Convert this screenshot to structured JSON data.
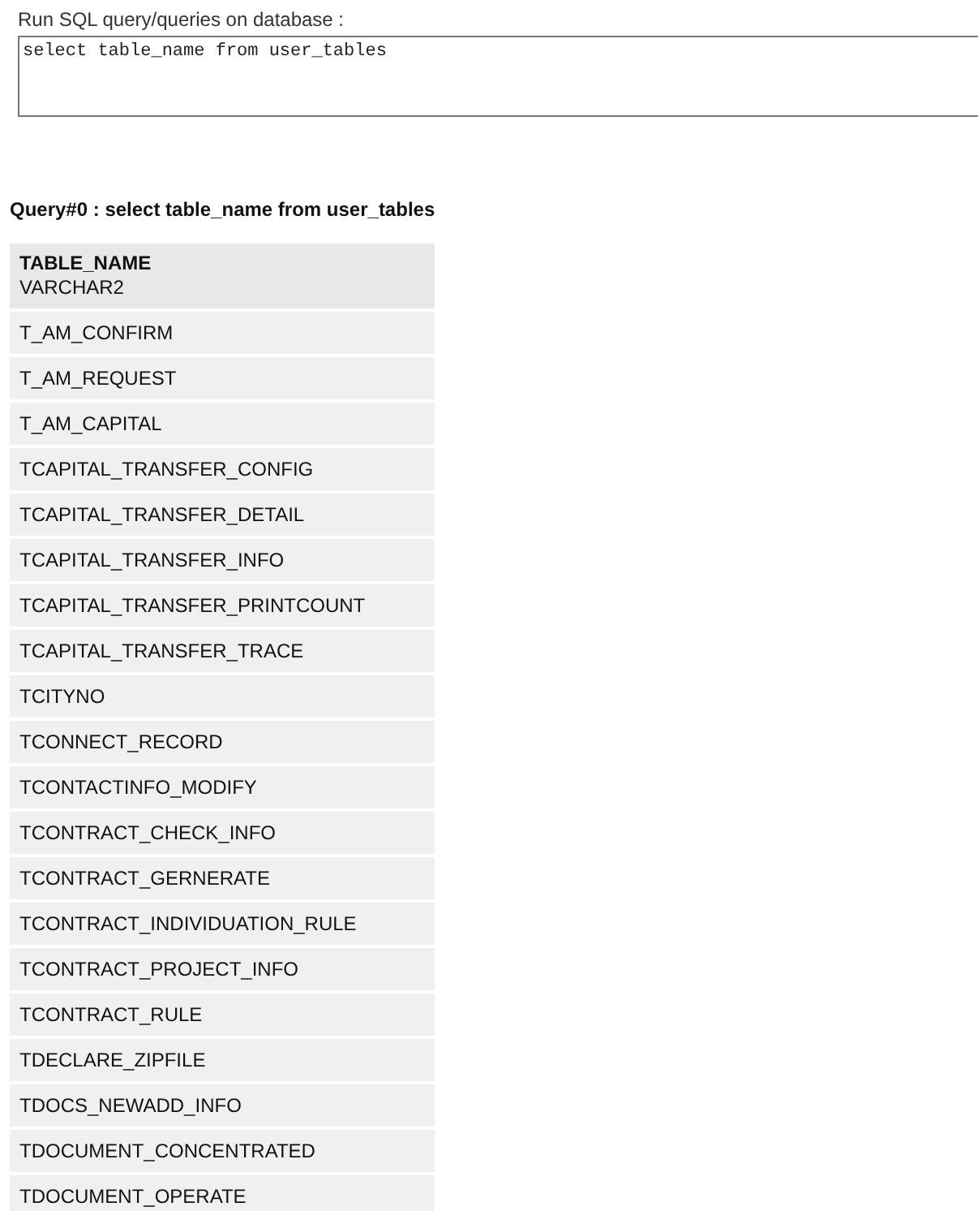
{
  "query_label": "Run SQL query/queries on database :",
  "query_input": {
    "value": "select table_name from user_tables"
  },
  "result_title": "Query#0 : select table_name from user_tables",
  "table": {
    "columns": [
      {
        "name": "TABLE_NAME",
        "type": "VARCHAR2"
      }
    ],
    "rows": [
      "T_AM_CONFIRM",
      "T_AM_REQUEST",
      "T_AM_CAPITAL",
      "TCAPITAL_TRANSFER_CONFIG",
      "TCAPITAL_TRANSFER_DETAIL",
      "TCAPITAL_TRANSFER_INFO",
      "TCAPITAL_TRANSFER_PRINTCOUNT",
      "TCAPITAL_TRANSFER_TRACE",
      "TCITYNO",
      "TCONNECT_RECORD",
      "TCONTACTINFO_MODIFY",
      "TCONTRACT_CHECK_INFO",
      "TCONTRACT_GERNERATE",
      "TCONTRACT_INDIVIDUATION_RULE",
      "TCONTRACT_PROJECT_INFO",
      "TCONTRACT_RULE",
      "TDECLARE_ZIPFILE",
      "TDOCS_NEWADD_INFO",
      "TDOCUMENT_CONCENTRATED",
      "TDOCUMENT_OPERATE"
    ]
  }
}
